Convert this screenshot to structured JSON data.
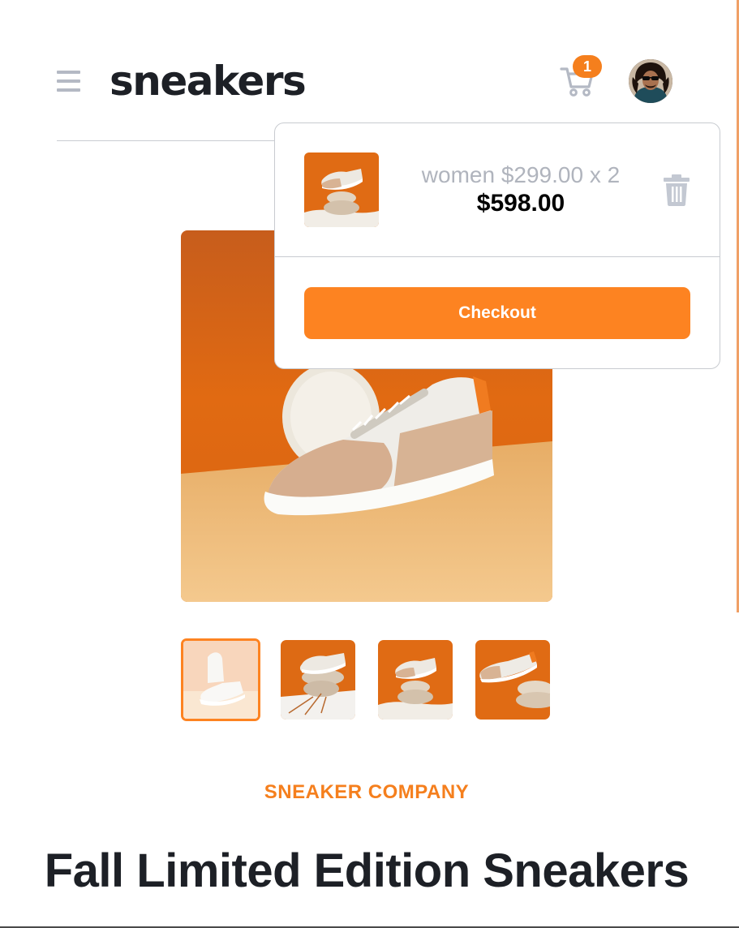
{
  "header": {
    "menu_icon": "hamburger-menu-icon",
    "logo": "sneakers",
    "cart_icon": "cart-icon",
    "cart_count": "1",
    "avatar_icon": "user-avatar"
  },
  "cart": {
    "item": {
      "name_price_qty": "women $299.00 x 2",
      "total": "$598.00",
      "delete_icon": "trash-icon"
    },
    "checkout_label": "Checkout"
  },
  "product": {
    "company": "SNEAKER COMPANY",
    "title": "Fall Limited Edition Sneakers"
  },
  "colors": {
    "accent": "#fd8321",
    "dark": "#1d2026",
    "muted": "#b0b4bd"
  }
}
